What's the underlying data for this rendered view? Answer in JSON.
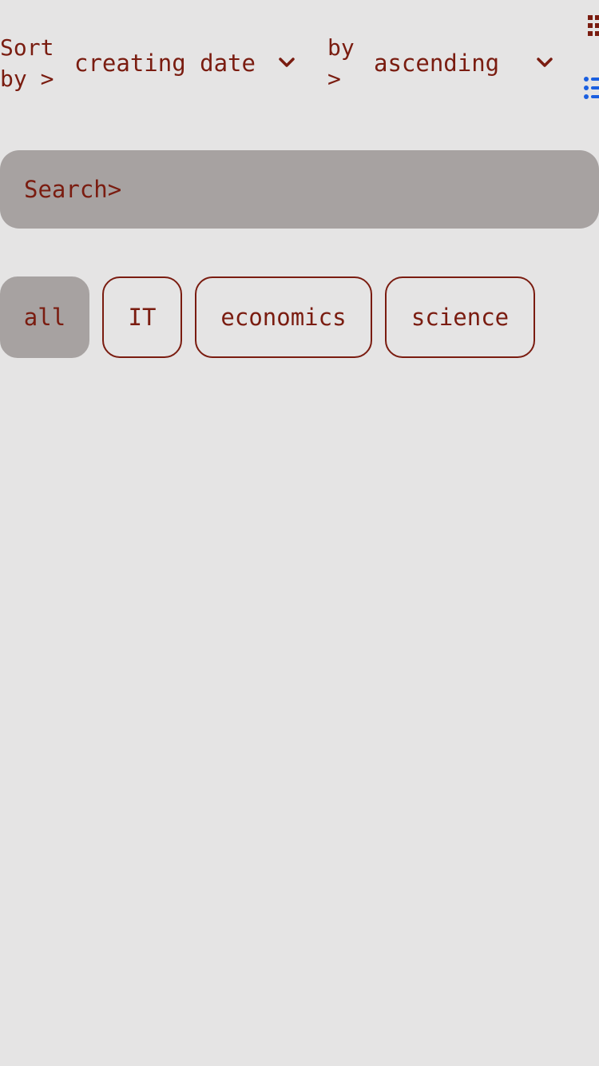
{
  "sort": {
    "sort_by_label_line1": "Sort",
    "sort_by_label_line2": "by >",
    "field_value": "creating date",
    "order_label_line1": "by",
    "order_label_line2": ">",
    "order_value": "ascending"
  },
  "view_toggle": {
    "grid_icon": "grid-icon",
    "list_icon": "list-icon",
    "active_color": "#1a5fe0"
  },
  "search": {
    "placeholder": "Search>"
  },
  "categories": {
    "items": [
      {
        "label": "all",
        "active": true
      },
      {
        "label": "IT",
        "active": false
      },
      {
        "label": "economics",
        "active": false
      },
      {
        "label": "science",
        "active": false
      }
    ]
  },
  "colors": {
    "background": "#e5e4e4",
    "text": "#7a1c10",
    "fill": "#a7a2a1"
  }
}
